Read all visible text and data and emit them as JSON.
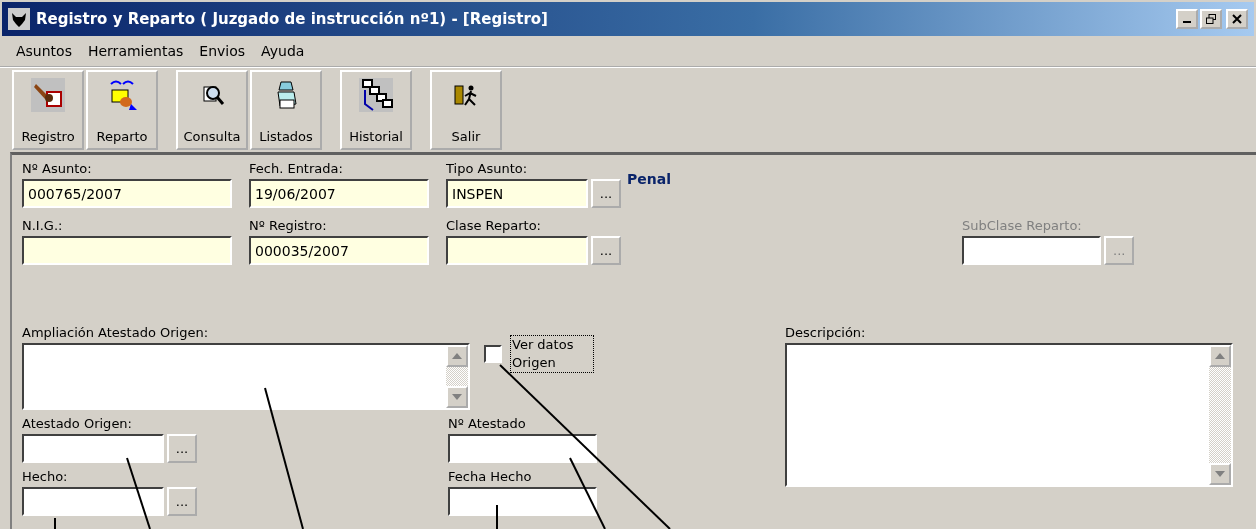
{
  "window": {
    "title": "Registro y Reparto  ( Juzgado de instrucción nº1) - [Registro]"
  },
  "menu": [
    {
      "label": "Asuntos"
    },
    {
      "label": "Herramientas"
    },
    {
      "label": "Envios"
    },
    {
      "label": "Ayuda"
    }
  ],
  "toolbar_groups": [
    {
      "buttons": [
        {
          "label": "Registro",
          "kind": "stamp",
          "highlighted": true
        },
        {
          "label": "Reparto",
          "kind": "folder",
          "highlighted": false
        }
      ]
    },
    {
      "buttons": [
        {
          "label": "Consulta",
          "kind": "magnifier",
          "highlighted": false
        },
        {
          "label": "Listados",
          "kind": "printer",
          "highlighted": false
        }
      ]
    },
    {
      "buttons": [
        {
          "label": "Historial",
          "kind": "flow",
          "highlighted": true
        }
      ]
    },
    {
      "buttons": [
        {
          "label": "Salir",
          "kind": "exit",
          "highlighted": false
        }
      ]
    }
  ],
  "top_columns": [
    {
      "fields": [
        {
          "label": "Nº Asunto:",
          "value": "000765/2007",
          "required": true,
          "disabled": false
        },
        {
          "label": "N.I.G.:",
          "required": true,
          "disabled": false
        }
      ]
    },
    {
      "fields": [
        {
          "label": "Fech. Entrada:",
          "value": "19/06/2007",
          "required": true,
          "disabled": false
        },
        {
          "label": "Nº Registro:",
          "value": "000035/2007",
          "required": true,
          "disabled": false
        }
      ]
    },
    {
      "fields": [
        {
          "label": "Tipo Asunto:",
          "value": "INSPEN",
          "required": true,
          "disabled": false,
          "button": "...",
          "note": "Penal"
        },
        {
          "label": "Clase Reparto:",
          "required": true,
          "disabled": false,
          "button": "..."
        }
      ]
    },
    {
      "fields": [
        {
          "label": "SubClase Reparto:",
          "required": false,
          "disabled": true,
          "button": "..."
        }
      ]
    }
  ],
  "ampliacion": {
    "label": "Ampliación Atestado Origen:"
  },
  "ver_datos": {
    "label": "Ver datos Origen",
    "checked": false,
    "focused": true
  },
  "bottom_columns": [
    {
      "fields": [
        {
          "label": "Atestado Origen:",
          "required": false,
          "disabled": false,
          "button": "..."
        },
        {
          "label": "Hecho:",
          "required": false,
          "disabled": false,
          "button": "..."
        }
      ]
    },
    {
      "fields": [
        {
          "label": "Nº Atestado",
          "required": false,
          "disabled": false
        },
        {
          "label": "Fecha Hecho",
          "required": false,
          "disabled": false
        }
      ]
    }
  ],
  "descripcion": {
    "label": "Descripción:"
  }
}
